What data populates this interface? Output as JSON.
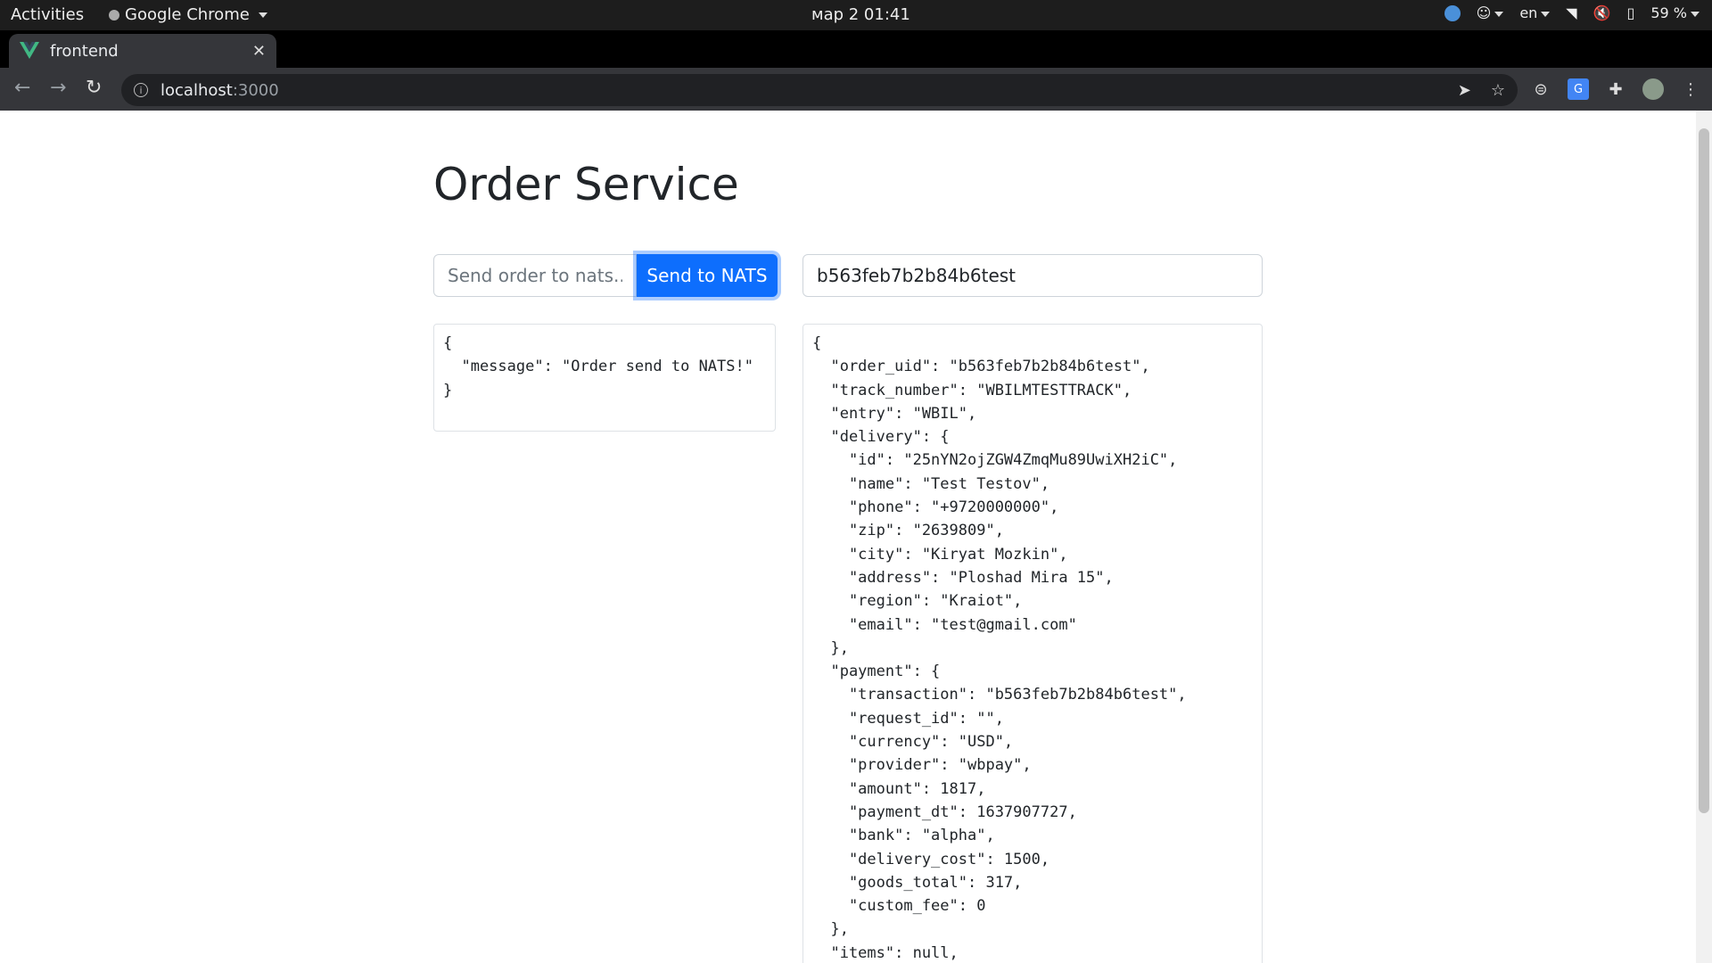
{
  "system": {
    "activities": "Activities",
    "app_name": "Google Chrome",
    "clock": "мар 2  01:41",
    "lang": "en",
    "battery": "59 %"
  },
  "browser": {
    "tab_title": "frontend",
    "url_host": "localhost",
    "url_port": ":3000"
  },
  "page": {
    "title": "Order Service",
    "send_input": {
      "placeholder": "Send order to nats...",
      "value": ""
    },
    "send_button": "Send to NATS",
    "uid_input": {
      "value": "b563feb7b2b84b6test"
    },
    "response_text": "{\n  \"message\": \"Order send to NATS!\"\n}",
    "order_text": "{\n  \"order_uid\": \"b563feb7b2b84b6test\",\n  \"track_number\": \"WBILMTESTTRACK\",\n  \"entry\": \"WBIL\",\n  \"delivery\": {\n    \"id\": \"25nYN2ojZGW4ZmqMu89UwiXH2iC\",\n    \"name\": \"Test Testov\",\n    \"phone\": \"+9720000000\",\n    \"zip\": \"2639809\",\n    \"city\": \"Kiryat Mozkin\",\n    \"address\": \"Ploshad Mira 15\",\n    \"region\": \"Kraiot\",\n    \"email\": \"test@gmail.com\"\n  },\n  \"payment\": {\n    \"transaction\": \"b563feb7b2b84b6test\",\n    \"request_id\": \"\",\n    \"currency\": \"USD\",\n    \"provider\": \"wbpay\",\n    \"amount\": 1817,\n    \"payment_dt\": 1637907727,\n    \"bank\": \"alpha\",\n    \"delivery_cost\": 1500,\n    \"goods_total\": 317,\n    \"custom_fee\": 0\n  },\n  \"items\": null,"
  }
}
